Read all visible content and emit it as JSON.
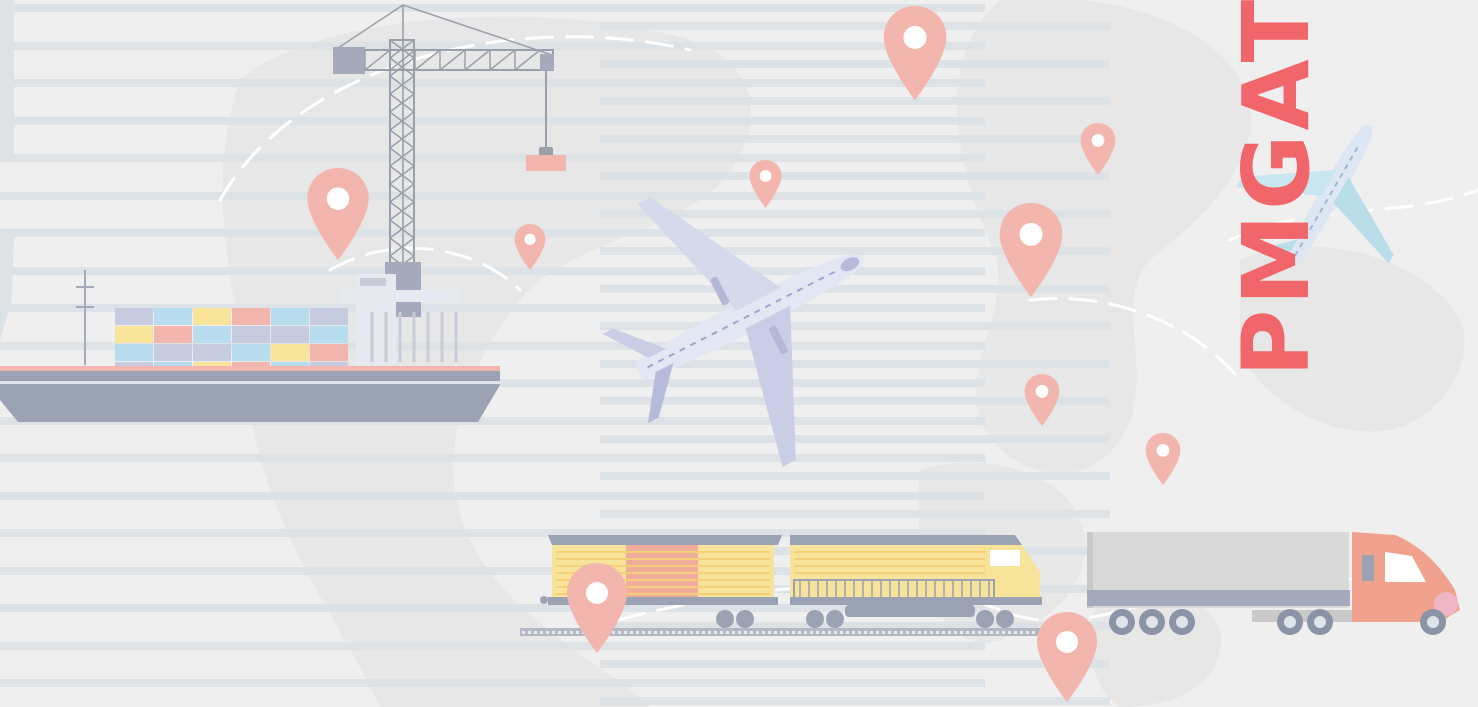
{
  "brand": {
    "text": "PMGAT"
  },
  "colors": {
    "background": "#efefef",
    "stripes": "#dde2e6",
    "pin": "#f2b6ae",
    "brand": "#f0666a",
    "hull": "#9aa2b4",
    "crane": "#9aa0ab",
    "train_yellow": "#f7e49a",
    "truck_cab": "#f0a28e"
  },
  "icons": [
    "container-ship-icon",
    "crane-icon",
    "airplane-icon",
    "train-icon",
    "truck-icon",
    "map-pin-icon"
  ]
}
